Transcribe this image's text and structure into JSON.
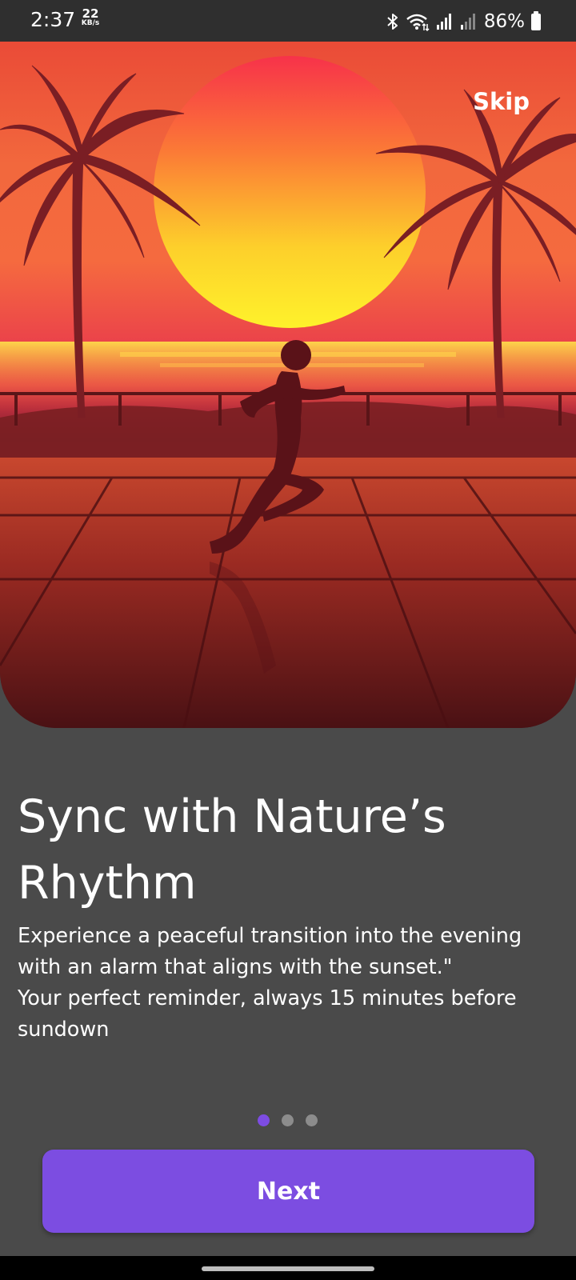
{
  "status_bar": {
    "time": "2:37",
    "net_speed_value": "22",
    "net_speed_unit": "KB/s",
    "battery_percent": "86%",
    "icons": [
      "bluetooth-icon",
      "wifi-icon",
      "signal-icon",
      "signal-icon",
      "battery-icon"
    ]
  },
  "hero": {
    "skip_label": "Skip",
    "illustration": "runner-at-sunset-with-palm-trees"
  },
  "content": {
    "title": "Sync with Nature’s Rhythm",
    "description_lines": [
      "Experience a peaceful transition into the evening",
      "with an alarm that aligns with the sunset.\"",
      "Your perfect reminder, always 15 minutes before",
      "sundown"
    ]
  },
  "pager": {
    "total_pages": 3,
    "current_page": 1
  },
  "actions": {
    "next_label": "Next"
  },
  "colors": {
    "background": "#4a4a4a",
    "accent": "#7c4de1",
    "dot_inactive": "#8c8c8c",
    "status_bar": "#2f2f2f"
  }
}
